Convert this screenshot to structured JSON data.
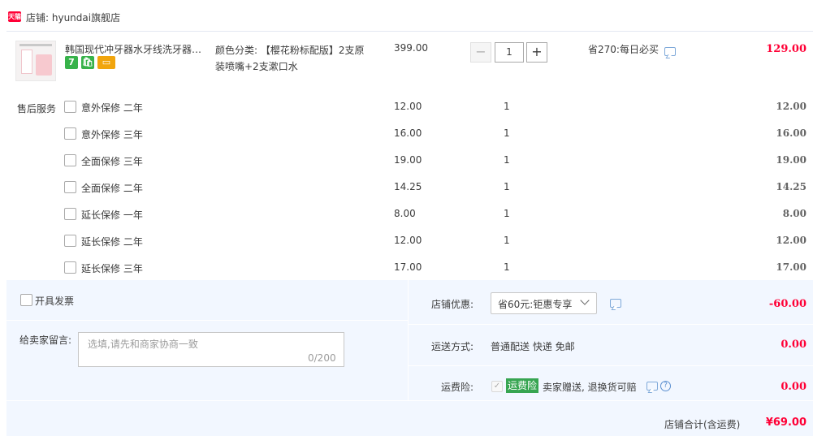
{
  "store": {
    "badge": "天猫",
    "name": "店铺: hyundai旗舰店"
  },
  "product": {
    "title": "韩国现代冲牙器水牙线洗牙器家...",
    "tags": [
      "7",
      "🛍",
      "▭"
    ],
    "variant": "颜色分类: 【樱花粉标配版】2支原装喷嘴+2支漱口水",
    "unit_price": "399.00",
    "quantity": "1",
    "qty_minus": "−",
    "qty_plus": "+",
    "promo": "省270:每日必买",
    "subtotal": "129.00"
  },
  "services": {
    "label": "售后服务",
    "items": [
      {
        "name": "意外保修 二年",
        "price": "12.00",
        "qty": "1",
        "total": "12.00"
      },
      {
        "name": "意外保修 三年",
        "price": "16.00",
        "qty": "1",
        "total": "16.00"
      },
      {
        "name": "全面保修 三年",
        "price": "19.00",
        "qty": "1",
        "total": "19.00"
      },
      {
        "name": "全面保修 二年",
        "price": "14.25",
        "qty": "1",
        "total": "14.25"
      },
      {
        "name": "延长保修 一年",
        "price": "8.00",
        "qty": "1",
        "total": "8.00"
      },
      {
        "name": "延长保修 二年",
        "price": "12.00",
        "qty": "1",
        "total": "12.00"
      },
      {
        "name": "延长保修 三年",
        "price": "17.00",
        "qty": "1",
        "total": "17.00"
      }
    ]
  },
  "invoice": {
    "label": "开具发票"
  },
  "note": {
    "label": "给卖家留言:",
    "placeholder": "选填,请先和商家协商一致",
    "count": "0/200"
  },
  "coupon": {
    "label": "店铺优惠:",
    "selected": "省60元:钜惠专享",
    "amount": "-60.00"
  },
  "shipping": {
    "label": "运送方式:",
    "value": "普通配送 快递 免邮",
    "amount": "0.00"
  },
  "insurance": {
    "label": "运费险:",
    "badge": "运费险",
    "text": "卖家赠送, 退换货可赔",
    "help": "?",
    "amount": "0.00"
  },
  "total": {
    "label": "店铺合计(含运费)",
    "amount": "¥69.00"
  },
  "colors": {
    "accent_red": "#ff0036",
    "panel_bg": "#f2f7ff",
    "badge_green": "#37a551"
  }
}
